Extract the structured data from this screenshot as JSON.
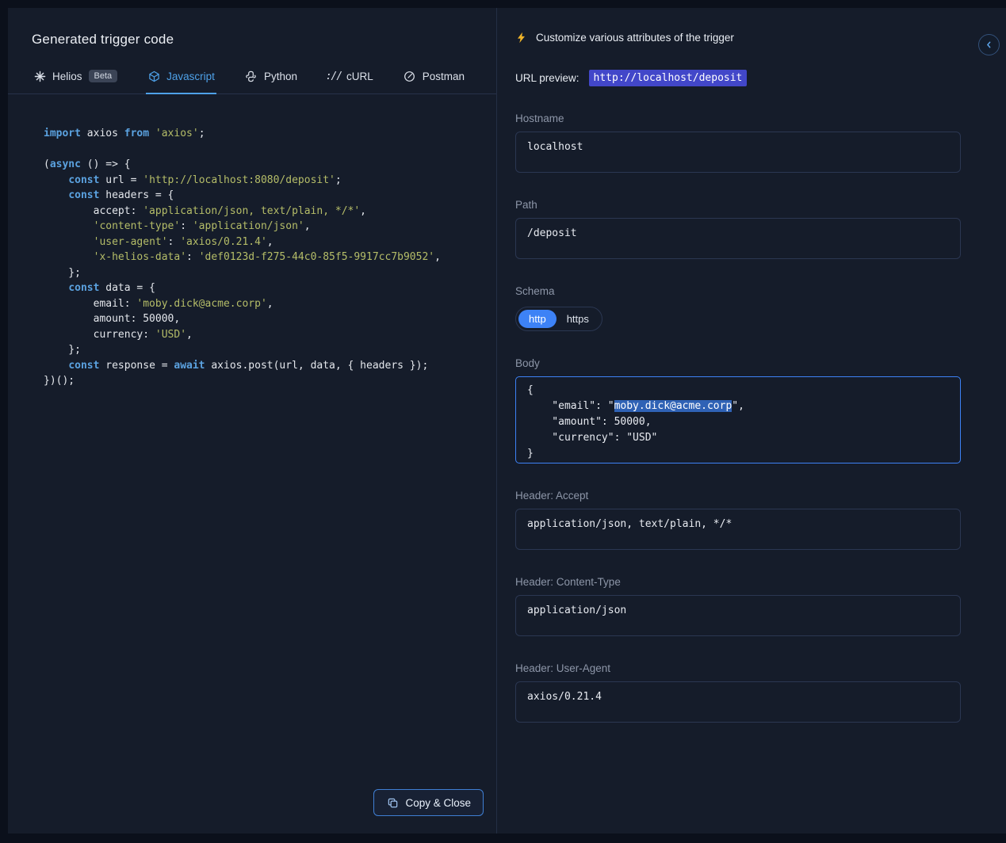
{
  "colors": {
    "accent": "#4ea1e8",
    "accent_strong": "#3d82f6",
    "url_highlight": "#4247c9",
    "selection": "#2f62b5",
    "keyword": "#5ba2e0",
    "string": "#b5bd68",
    "bolt": "#f0b429"
  },
  "left": {
    "title": "Generated trigger code",
    "tabs": [
      {
        "label": "Helios",
        "badge": "Beta",
        "icon": "helios-icon"
      },
      {
        "label": "Javascript",
        "icon": "javascript-icon"
      },
      {
        "label": "Python",
        "icon": "python-icon"
      },
      {
        "label": "cURL",
        "icon": "curl-icon",
        "icon_glyph": "://"
      },
      {
        "label": "Postman",
        "icon": "postman-icon"
      }
    ],
    "copy_close_label": "Copy & Close",
    "code_lines": [
      [
        {
          "t": "k",
          "v": "import"
        },
        {
          "t": "p",
          "v": " axios "
        },
        {
          "t": "k",
          "v": "from"
        },
        {
          "t": "p",
          "v": " "
        },
        {
          "t": "s",
          "v": "'axios'"
        },
        {
          "t": "p",
          "v": ";"
        }
      ],
      [],
      [
        {
          "t": "p",
          "v": "("
        },
        {
          "t": "k",
          "v": "async"
        },
        {
          "t": "p",
          "v": " () => {"
        }
      ],
      [
        {
          "t": "p",
          "v": "    "
        },
        {
          "t": "k",
          "v": "const"
        },
        {
          "t": "p",
          "v": " url = "
        },
        {
          "t": "s",
          "v": "'http://localhost:8080/deposit'"
        },
        {
          "t": "p",
          "v": ";"
        }
      ],
      [
        {
          "t": "p",
          "v": "    "
        },
        {
          "t": "k",
          "v": "const"
        },
        {
          "t": "p",
          "v": " headers = {"
        }
      ],
      [
        {
          "t": "p",
          "v": "        accept: "
        },
        {
          "t": "s",
          "v": "'application/json, text/plain, */*'"
        },
        {
          "t": "p",
          "v": ","
        }
      ],
      [
        {
          "t": "p",
          "v": "        "
        },
        {
          "t": "s",
          "v": "'content-type'"
        },
        {
          "t": "p",
          "v": ": "
        },
        {
          "t": "s",
          "v": "'application/json'"
        },
        {
          "t": "p",
          "v": ","
        }
      ],
      [
        {
          "t": "p",
          "v": "        "
        },
        {
          "t": "s",
          "v": "'user-agent'"
        },
        {
          "t": "p",
          "v": ": "
        },
        {
          "t": "s",
          "v": "'axios/0.21.4'"
        },
        {
          "t": "p",
          "v": ","
        }
      ],
      [
        {
          "t": "p",
          "v": "        "
        },
        {
          "t": "s",
          "v": "'x-helios-data'"
        },
        {
          "t": "p",
          "v": ": "
        },
        {
          "t": "s",
          "v": "'def0123d-f275-44c0-85f5-9917cc7b9052'"
        },
        {
          "t": "p",
          "v": ","
        }
      ],
      [
        {
          "t": "p",
          "v": "    };"
        }
      ],
      [
        {
          "t": "p",
          "v": "    "
        },
        {
          "t": "k",
          "v": "const"
        },
        {
          "t": "p",
          "v": " data = {"
        }
      ],
      [
        {
          "t": "p",
          "v": "        email: "
        },
        {
          "t": "s",
          "v": "'moby.dick@acme.corp'"
        },
        {
          "t": "p",
          "v": ","
        }
      ],
      [
        {
          "t": "p",
          "v": "        amount: 50000,"
        }
      ],
      [
        {
          "t": "p",
          "v": "        currency: "
        },
        {
          "t": "s",
          "v": "'USD'"
        },
        {
          "t": "p",
          "v": ","
        }
      ],
      [
        {
          "t": "p",
          "v": "    };"
        }
      ],
      [
        {
          "t": "p",
          "v": "    "
        },
        {
          "t": "k",
          "v": "const"
        },
        {
          "t": "p",
          "v": " response = "
        },
        {
          "t": "k",
          "v": "await"
        },
        {
          "t": "p",
          "v": " axios.post(url, data, { headers });"
        }
      ],
      [
        {
          "t": "p",
          "v": "})();"
        }
      ]
    ]
  },
  "right": {
    "header": "Customize various attributes of the trigger",
    "url_preview": {
      "label": "URL preview:",
      "value": "http://localhost/deposit"
    },
    "hostname": {
      "label": "Hostname",
      "value": "localhost"
    },
    "path": {
      "label": "Path",
      "value": "/deposit"
    },
    "schema": {
      "label": "Schema",
      "options": [
        "http",
        "https"
      ],
      "selected": "http"
    },
    "body": {
      "label": "Body",
      "before": "{\n    \"email\": \"",
      "selected": "moby.dick@acme.corp",
      "after": "\",\n    \"amount\": 50000,\n    \"currency\": \"USD\"\n}"
    },
    "headers": [
      {
        "label": "Header: Accept",
        "value": "application/json, text/plain, */*"
      },
      {
        "label": "Header: Content-Type",
        "value": "application/json"
      },
      {
        "label": "Header: User-Agent",
        "value": "axios/0.21.4"
      }
    ]
  }
}
